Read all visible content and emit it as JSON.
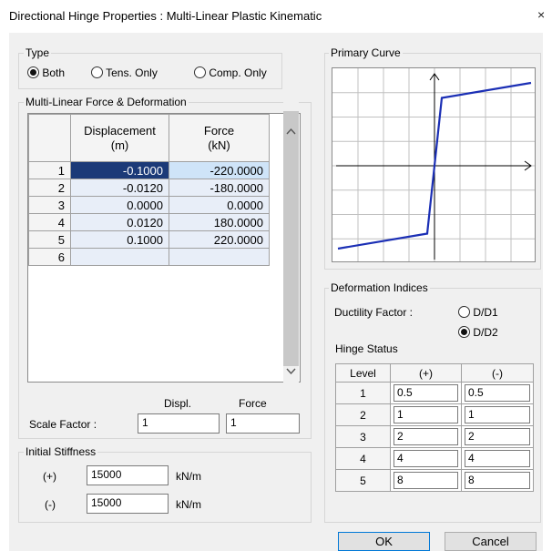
{
  "window": {
    "title": "Directional Hinge Properties : Multi-Linear Plastic Kinematic",
    "close_glyph": "×"
  },
  "type_group": {
    "label": "Type",
    "options": [
      {
        "label": "Both",
        "selected": true
      },
      {
        "label": "Tens. Only",
        "selected": false
      },
      {
        "label": "Comp. Only",
        "selected": false
      }
    ]
  },
  "force_deformation": {
    "label": "Multi-Linear Force & Deformation",
    "columns": [
      {
        "line1": "Displacement",
        "line2": "(m)"
      },
      {
        "line1": "Force",
        "line2": "(kN)"
      }
    ],
    "rows": [
      {
        "num": "1",
        "disp": "-0.1000",
        "force": "-220.0000"
      },
      {
        "num": "2",
        "disp": "-0.0120",
        "force": "-180.0000"
      },
      {
        "num": "3",
        "disp": "0.0000",
        "force": "0.0000"
      },
      {
        "num": "4",
        "disp": "0.0120",
        "force": "180.0000"
      },
      {
        "num": "5",
        "disp": "0.1000",
        "force": "220.0000"
      },
      {
        "num": "6",
        "disp": "",
        "force": ""
      }
    ],
    "scale": {
      "label": "Scale Factor :",
      "displ_label": "Displ.",
      "force_label": "Force",
      "displ_value": "1",
      "force_value": "1"
    }
  },
  "initial_stiffness": {
    "label": "Initial Stiffness",
    "plus_label": "(+)",
    "minus_label": "(-)",
    "plus_value": "15000",
    "minus_value": "15000",
    "unit": "kN/m"
  },
  "primary_curve": {
    "label": "Primary Curve",
    "curve_color": "#1b2fb5",
    "points": [
      [
        -0.1,
        -220
      ],
      [
        -0.012,
        -180
      ],
      [
        0,
        0
      ],
      [
        0.012,
        180
      ],
      [
        0.1,
        220
      ]
    ]
  },
  "deformation_indices": {
    "label": "Deformation Indices",
    "ductility_label": "Ductility Factor :",
    "options": [
      {
        "label": "D/D1",
        "selected": false
      },
      {
        "label": "D/D2",
        "selected": true
      }
    ],
    "hinge_status_label": "Hinge Status",
    "columns": [
      "Level",
      "(+)",
      "(-)"
    ],
    "rows": [
      {
        "level": "1",
        "plus": "0.5",
        "minus": "0.5"
      },
      {
        "level": "2",
        "plus": "1",
        "minus": "1"
      },
      {
        "level": "3",
        "plus": "2",
        "minus": "2"
      },
      {
        "level": "4",
        "plus": "4",
        "minus": "4"
      },
      {
        "level": "5",
        "plus": "8",
        "minus": "8"
      }
    ]
  },
  "buttons": {
    "ok": "OK",
    "cancel": "Cancel"
  }
}
